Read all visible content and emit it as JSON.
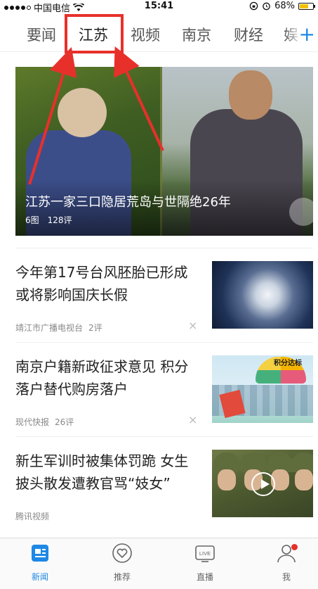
{
  "status_bar": {
    "carrier": "中国电信",
    "time": "15:41",
    "battery": "68%",
    "battery_level": 0.68
  },
  "tabs": [
    {
      "label": "要闻",
      "active": false
    },
    {
      "label": "江苏",
      "active": true
    },
    {
      "label": "视频",
      "active": false
    },
    {
      "label": "南京",
      "active": false
    },
    {
      "label": "财经",
      "active": false
    },
    {
      "label": "娱",
      "active": false
    }
  ],
  "add_tab": "+",
  "hero": {
    "title": "江苏一家三口隐居荒岛与世隔绝26年",
    "images": "6图",
    "comments": "128评"
  },
  "news": [
    {
      "title": "今年第17号台风胚胎已形成 或将影响国庆长假",
      "source": "靖江市广播电视台",
      "comments": "2评",
      "close": "×"
    },
    {
      "title": "南京户籍新政征求意见 积分落户替代购房落户",
      "source": "现代快报",
      "comments": "26评",
      "close": "×",
      "thumb_label": "积分达标"
    },
    {
      "title": "新生军训时被集体罚跪 女生披头散发遭教官骂“妓女”",
      "source": "腾讯视频",
      "comments": "",
      "close": ""
    }
  ],
  "bottom_nav": [
    {
      "label": "新闻",
      "icon": "news-icon",
      "active": true
    },
    {
      "label": "推荐",
      "icon": "heart-icon",
      "active": false
    },
    {
      "label": "直播",
      "icon": "live-tv-icon",
      "active": false,
      "badge_text": "LIVE"
    },
    {
      "label": "我",
      "icon": "user-icon",
      "active": false,
      "has_badge": true
    }
  ],
  "colors": {
    "accent": "#1e88e5",
    "highlight": "#e8302a"
  }
}
